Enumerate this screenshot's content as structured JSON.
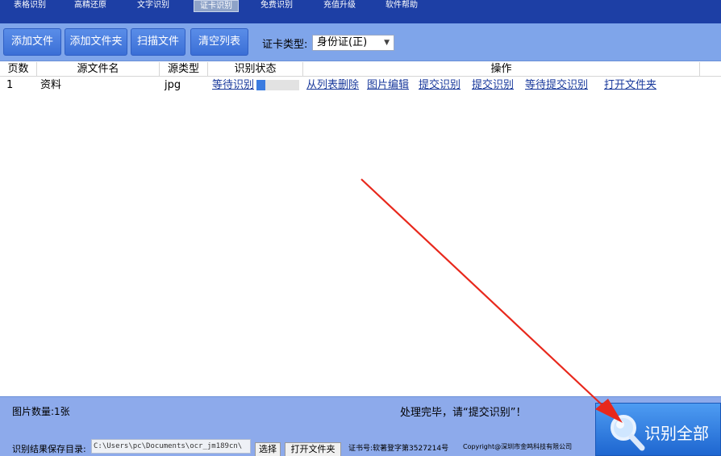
{
  "nav": {
    "tabs": [
      {
        "label": "表格识别"
      },
      {
        "label": "高精还原"
      },
      {
        "label": "文字识别"
      },
      {
        "label": "证卡识别",
        "active": true
      },
      {
        "label": "免费识别"
      },
      {
        "label": "充值升级"
      },
      {
        "label": "软件帮助"
      }
    ]
  },
  "toolbar": {
    "add_file": "添加文件",
    "add_folder": "添加文件夹",
    "scan_file": "扫描文件",
    "clear_list": "清空列表",
    "card_type_label": "证卡类型:",
    "card_type_value": "身份证(正)"
  },
  "table": {
    "columns": [
      "页数",
      "源文件名",
      "源类型",
      "识别状态",
      "操作"
    ],
    "rows": [
      {
        "page": "1",
        "filename": "资料",
        "type": "jpg",
        "status": "等待识别",
        "progress": 0.2,
        "actions": [
          "从列表删除",
          "图片编辑",
          "提交识别",
          "提交识别",
          "等待提交识别",
          "打开文件夹"
        ]
      }
    ]
  },
  "status": {
    "image_count": "图片数量:1张",
    "message": "处理完毕，请“提交识别”！",
    "save_dir_label": "识别结果保存目录:",
    "save_dir_value": "C:\\Users\\pc\\Documents\\ocr_jm189cn\\",
    "select_button": "选择",
    "open_folder_button": "打开文件夹",
    "cert_no": "证书号:软著登字第3527214号",
    "copyright": "Copyright@深圳市金鸣科技有限公司"
  },
  "recognize_all": {
    "label": "识别全部",
    "icon": "magnifier-icon"
  },
  "colors": {
    "nav_bg": "#1d3fa5",
    "toolbar_bg": "#7fa5ea",
    "link": "#1a3a9c",
    "annotation_arrow": "#e8281c"
  }
}
